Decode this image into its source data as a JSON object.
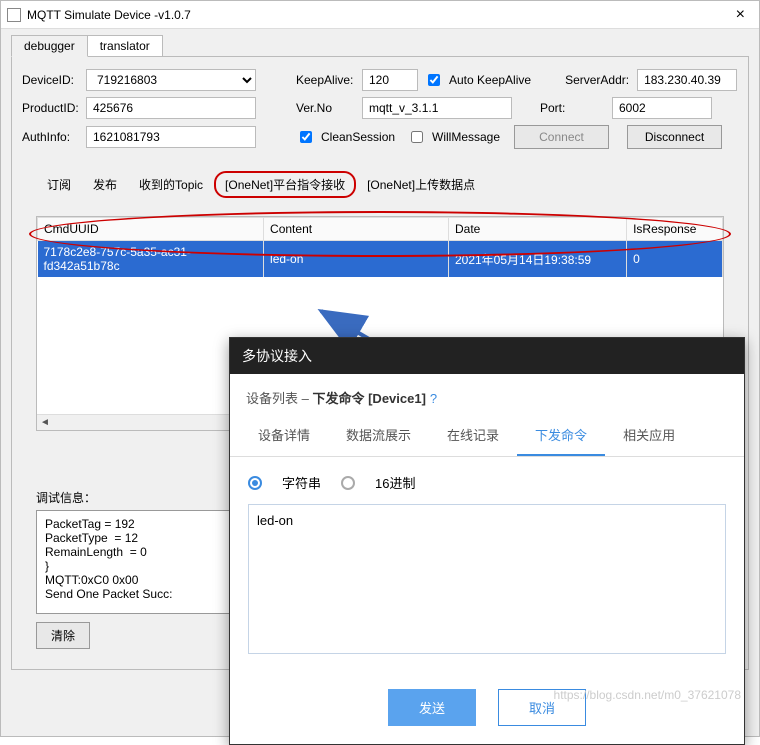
{
  "window": {
    "title": "MQTT Simulate Device  -v1.0.7"
  },
  "outer_tabs": [
    "debugger",
    "translator"
  ],
  "form": {
    "device_id_label": "DeviceID:",
    "device_id": "719216803",
    "product_id_label": "ProductID:",
    "product_id": "425676",
    "auth_info_label": "AuthInfo:",
    "auth_info": "1621081793",
    "keep_alive_label": "KeepAlive:",
    "keep_alive": "120",
    "auto_keep_alive_label": "Auto KeepAlive",
    "ver_label": "Ver.No",
    "ver": "mqtt_v_3.1.1",
    "clean_session_label": "CleanSession",
    "will_label": "WillMessage",
    "server_label": "ServerAddr:",
    "server": "183.230.40.39",
    "port_label": "Port:",
    "port": "6002",
    "connect_label": "Connect",
    "disconnect_label": "Disconnect"
  },
  "inner_tabs": [
    "订阅",
    "发布",
    "收到的Topic",
    "[OneNet]平台指令接收",
    "[OneNet]上传数据点"
  ],
  "table": {
    "headers": [
      "CmdUUID",
      "Content",
      "Date",
      "IsResponse"
    ],
    "row": {
      "uuid": "7178c2e8-757c-5a35-ac31-fd342a51b78c",
      "content": "led-on",
      "date": "2021年05月14日19:38:59",
      "resp": "0"
    }
  },
  "debug": {
    "label": "调试信息：",
    "text": "PacketTag = 192\nPacketType  = 12\nRemainLength  = 0\n}\nMQTT:0xC0 0x00\nSend One Packet Succ:",
    "clear": "清除"
  },
  "overlay": {
    "title": "多协议接入",
    "crumb_a": "设备列表",
    "crumb_sep": " – ",
    "crumb_b": "下发命令 [Device1]",
    "q": "?",
    "tabs": [
      "设备详情",
      "数据流展示",
      "在线记录",
      "下发命令",
      "相关应用"
    ],
    "radio_a": "字符串",
    "radio_b": "16进制",
    "textarea": "led-on",
    "send": "发送",
    "cancel": "取消"
  },
  "watermark": "https://blog.csdn.net/m0_37621078"
}
